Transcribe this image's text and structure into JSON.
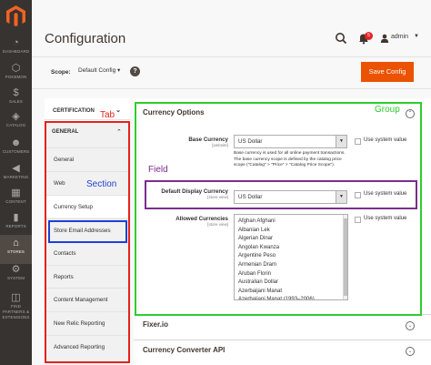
{
  "nav": {
    "items": [
      {
        "label": "DASHBOARD",
        "icon": "dashboard-icon",
        "glyph": "◔"
      },
      {
        "label": "POKEMON",
        "icon": "pokemon-icon",
        "glyph": "⬡"
      },
      {
        "label": "SALES",
        "icon": "dollar-icon",
        "glyph": "$"
      },
      {
        "label": "CATALOG",
        "icon": "catalog-icon",
        "glyph": "◈"
      },
      {
        "label": "CUSTOMERS",
        "icon": "customers-icon",
        "glyph": "☻"
      },
      {
        "label": "MARKETING",
        "icon": "megaphone-icon",
        "glyph": "◀"
      },
      {
        "label": "CONTENT",
        "icon": "content-icon",
        "glyph": "▦"
      },
      {
        "label": "REPORTS",
        "icon": "reports-icon",
        "glyph": "▮"
      },
      {
        "label": "STORES",
        "icon": "stores-icon",
        "glyph": "⌂"
      },
      {
        "label": "SYSTEM",
        "icon": "gear-icon",
        "glyph": "⚙"
      },
      {
        "label": "FIND PARTNERS & EXTENSIONS",
        "icon": "extensions-icon",
        "glyph": "◫"
      }
    ]
  },
  "header": {
    "title": "Configuration",
    "notification_count": "5",
    "user": "admin"
  },
  "scope": {
    "label": "Scope:",
    "value": "Default Config",
    "help": "?",
    "save_label": "Save Config"
  },
  "tabs": {
    "certification": "CERTIFICATION",
    "general": "GENERAL",
    "sections": [
      "General",
      "Web",
      "Currency Setup",
      "Store Email Addresses",
      "Contacts",
      "Reports",
      "Content Management",
      "New Relic Reporting",
      "Advanced Reporting"
    ]
  },
  "currency_options": {
    "title": "Currency Options",
    "base": {
      "label": "Base Currency",
      "scope": "[website]",
      "value": "US Dollar",
      "note": "Base currency is used for all online payment transactions. The base currency scope is defined by the catalog price scope (\"Catalog\" > \"Price\" > \"Catalog Price Scope\")."
    },
    "display": {
      "label": "Default Display Currency",
      "scope": "[store view]",
      "value": "US Dollar"
    },
    "allowed": {
      "label": "Allowed Currencies",
      "scope": "[store view]",
      "options": [
        "Afghan Afghani",
        "Albanian Lek",
        "Algerian Dinar",
        "Angolan Kwanza",
        "Argentine Peso",
        "Armenian Dram",
        "Aruban Florin",
        "Australian Dollar",
        "Azerbaijani Manat",
        "Azerbaijani Manat (1993–2006)"
      ]
    },
    "use_system_value": "Use system value"
  },
  "other_groups": [
    "Fixer.io",
    "Currency Converter API"
  ],
  "annotations": {
    "tab": "Tab",
    "group": "Group",
    "field": "Field",
    "section": "Section",
    "colors": {
      "red": "#e2231a",
      "green": "#2ecc2e",
      "purple": "#7b2d8e",
      "blue": "#1f3fd6"
    }
  }
}
